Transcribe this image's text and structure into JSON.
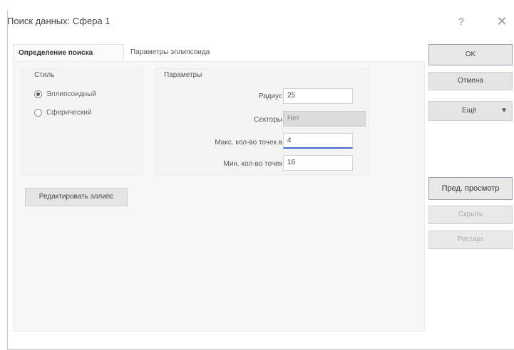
{
  "window": {
    "title": "Поиск данных: Сфера 1",
    "help_icon": "?",
    "close_icon": "✕"
  },
  "tabs": [
    {
      "label": "Определение поиска",
      "active": true
    },
    {
      "label": "Параметры эллипсоида",
      "active": false
    }
  ],
  "style_group": {
    "title": "Стиль",
    "options": [
      {
        "label": "Эллипсоидный",
        "selected": true
      },
      {
        "label": "Сферический",
        "selected": false
      }
    ]
  },
  "params_group": {
    "title": "Параметры",
    "fields": [
      {
        "label": "Радиус",
        "value": "25"
      },
      {
        "label": "Секторы",
        "value": "Нет"
      },
      {
        "label": "Макс. кол-во точек в",
        "value": "4"
      },
      {
        "label": "Мин. кол-во точек",
        "value": "16"
      }
    ]
  },
  "buttons": {
    "edit_ellipse": "Редактировать эллипс",
    "ok": "OK",
    "cancel": "Отмена",
    "more": "Ещё",
    "preview": "Пред. просмотр",
    "hide": "Скрыть",
    "restart": "Рестарт"
  }
}
